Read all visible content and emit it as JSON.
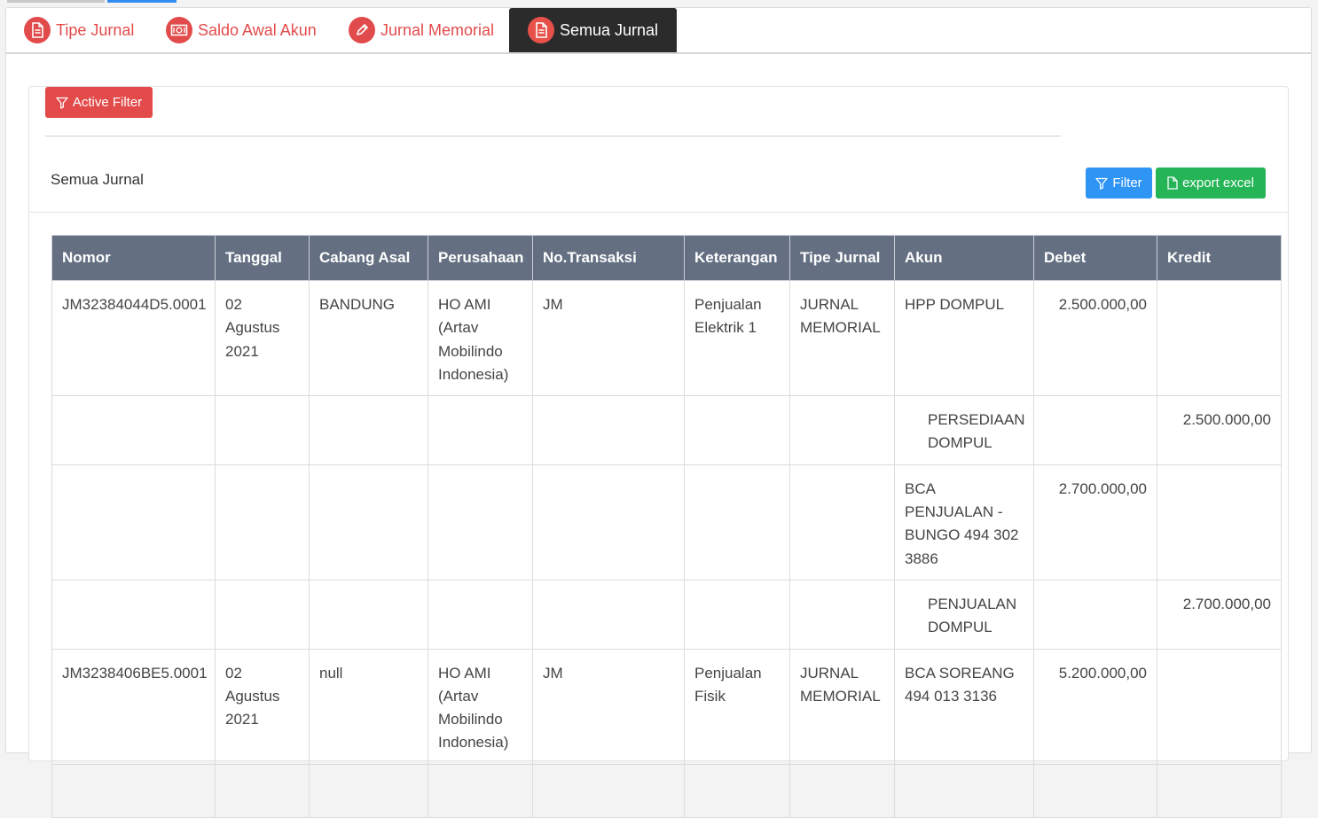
{
  "tabs": [
    {
      "label": "Tipe Jurnal",
      "icon": "document-icon"
    },
    {
      "label": "Saldo Awal Akun",
      "icon": "money-icon"
    },
    {
      "label": "Jurnal Memorial",
      "icon": "pencil-icon"
    },
    {
      "label": "Semua Jurnal",
      "icon": "document-icon",
      "active": true
    }
  ],
  "buttons": {
    "active_filter": "Active Filter",
    "filter": "Filter",
    "export": "export excel"
  },
  "card": {
    "title": "Semua Jurnal"
  },
  "table": {
    "headers": [
      "Nomor",
      "Tanggal",
      "Cabang Asal",
      "Perusahaan",
      "No.Transaksi",
      "Keterangan",
      "Tipe Jurnal",
      "Akun",
      "Debet",
      "Kredit"
    ],
    "rows": [
      {
        "nomor": "JM32384044D5.0001",
        "tanggal": "02 Agustus 2021",
        "cabang": "BANDUNG",
        "perusahaan": "HO AMI (Artav Mobilindo Indonesia)",
        "transaksi": "JM",
        "keterangan": "Penjualan Elektrik 1",
        "tipe": "JURNAL MEMORIAL",
        "akun": "HPP DOMPUL",
        "debet": "2.500.000,00",
        "kredit": ""
      },
      {
        "nomor": "",
        "tanggal": "",
        "cabang": "",
        "perusahaan": "",
        "transaksi": "",
        "keterangan": "",
        "tipe": "",
        "akun": "PERSEDIAAN DOMPUL",
        "debet": "",
        "kredit": "2.500.000,00"
      },
      {
        "nomor": "",
        "tanggal": "",
        "cabang": "",
        "perusahaan": "",
        "transaksi": "",
        "keterangan": "",
        "tipe": "",
        "akun": "BCA PENJUALAN - BUNGO 494 302 3886",
        "debet": "2.700.000,00",
        "kredit": ""
      },
      {
        "nomor": "",
        "tanggal": "",
        "cabang": "",
        "perusahaan": "",
        "transaksi": "",
        "keterangan": "",
        "tipe": "",
        "akun": "PENJUALAN DOMPUL",
        "debet": "",
        "kredit": "2.700.000,00"
      },
      {
        "nomor": "JM3238406BE5.0001",
        "tanggal": "02 Agustus 2021",
        "cabang": "null",
        "perusahaan": "HO AMI (Artav Mobilindo Indonesia)",
        "transaksi": "JM",
        "keterangan": "Penjualan Fisik",
        "tipe": "JURNAL MEMORIAL",
        "akun": "BCA SOREANG 494 013 3136",
        "debet": "5.200.000,00",
        "kredit": ""
      },
      {
        "nomor": "",
        "tanggal": "",
        "cabang": "",
        "perusahaan": "",
        "transaksi": "",
        "keterangan": "",
        "tipe": "",
        "akun": "",
        "debet": "",
        "kredit": ""
      }
    ]
  },
  "colors": {
    "accent_red": "#e24b4b",
    "tab_active_bg": "#2b2b2b",
    "header_bg": "#647082",
    "filter_blue": "#2f95f5",
    "export_green": "#25b556"
  }
}
